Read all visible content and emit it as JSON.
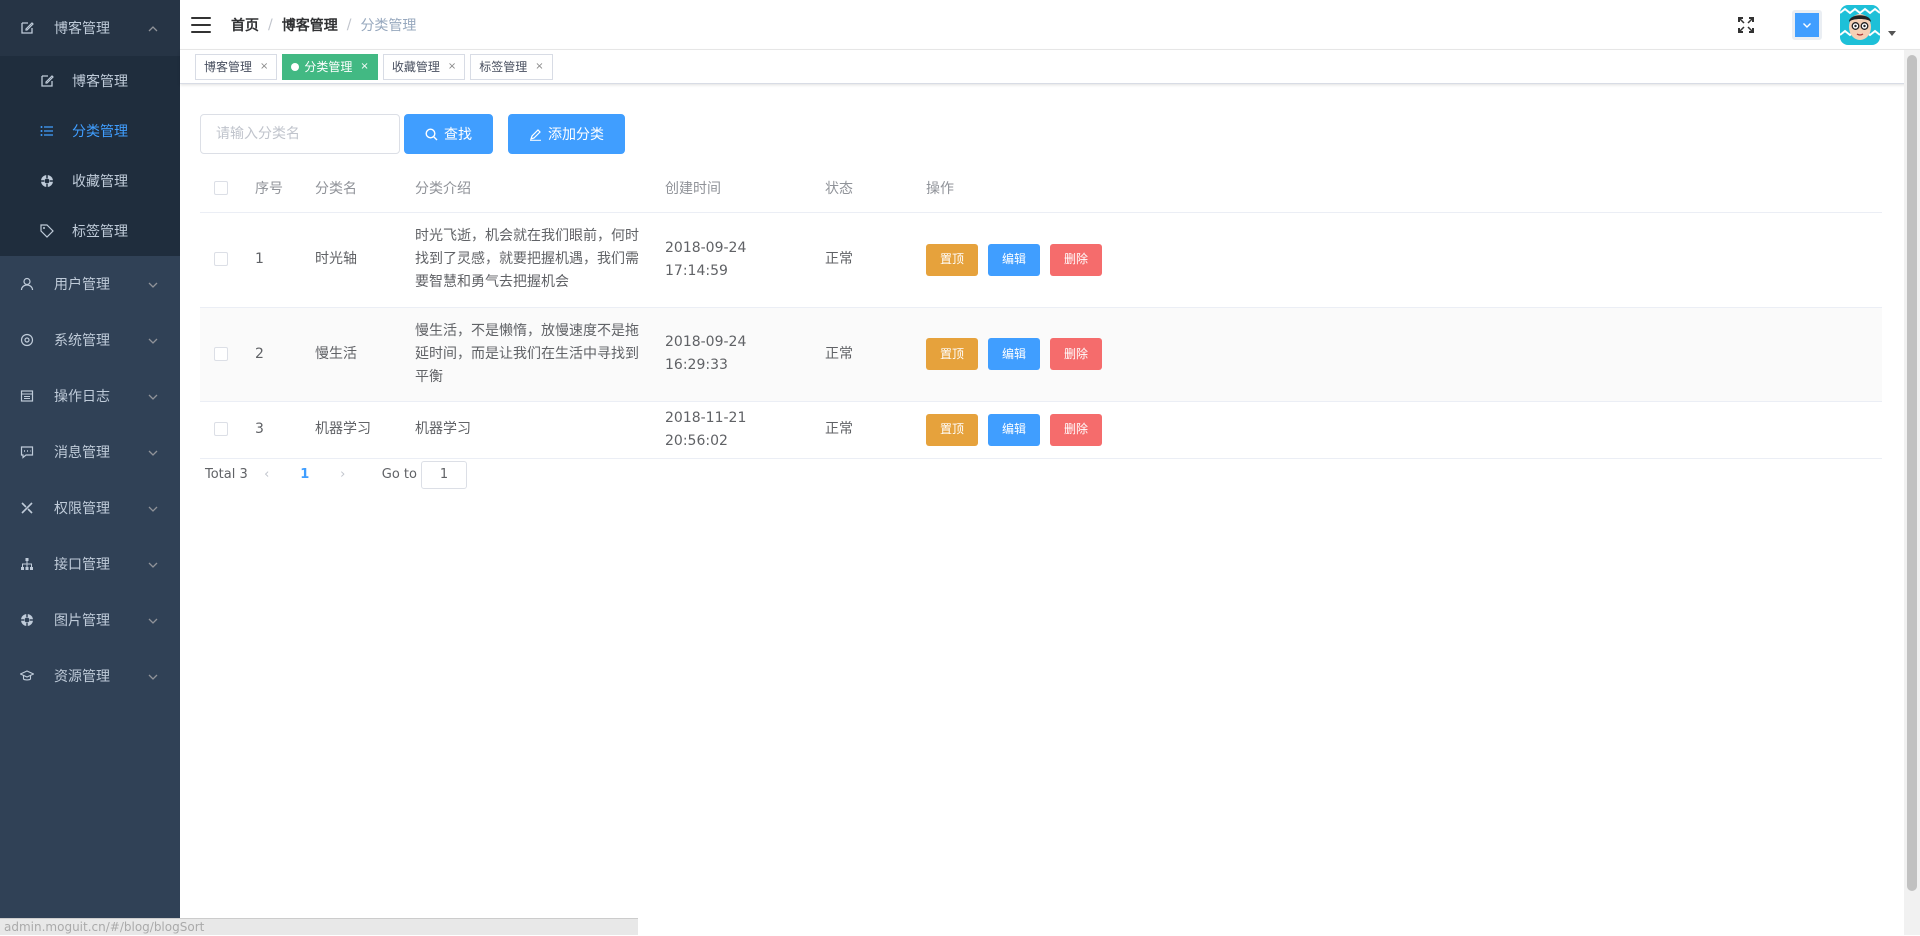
{
  "sidebar": {
    "groups": [
      {
        "label": "博客管理",
        "icon": "edit-icon",
        "expanded": true,
        "items": [
          {
            "label": "博客管理",
            "icon": "edit-icon"
          },
          {
            "label": "分类管理",
            "icon": "list-icon",
            "active": true
          },
          {
            "label": "收藏管理",
            "icon": "lifebuoy-icon"
          },
          {
            "label": "标签管理",
            "icon": "tag-icon"
          }
        ]
      },
      {
        "label": "用户管理",
        "icon": "user-icon"
      },
      {
        "label": "系统管理",
        "icon": "settings-icon"
      },
      {
        "label": "操作日志",
        "icon": "calendar-icon"
      },
      {
        "label": "消息管理",
        "icon": "message-icon"
      },
      {
        "label": "权限管理",
        "icon": "tools-icon"
      },
      {
        "label": "接口管理",
        "icon": "sitemap-icon"
      },
      {
        "label": "图片管理",
        "icon": "lifebuoy-icon"
      },
      {
        "label": "资源管理",
        "icon": "graduation-cap-icon"
      }
    ],
    "status_url": "admin.moguit.cn/#/blog/blogSort"
  },
  "breadcrumb": {
    "home": "首页",
    "parent": "博客管理",
    "current": "分类管理",
    "separator": "/"
  },
  "tags": [
    {
      "label": "博客管理",
      "close": "×"
    },
    {
      "label": "分类管理",
      "close": "×",
      "active": true
    },
    {
      "label": "收藏管理",
      "close": "×"
    },
    {
      "label": "标签管理",
      "close": "×"
    }
  ],
  "filter": {
    "placeholder": "请输入分类名",
    "search_label": "查找",
    "add_label": "添加分类"
  },
  "table": {
    "headers": [
      "序号",
      "分类名",
      "分类介绍",
      "创建时间",
      "状态",
      "操作"
    ],
    "rows": [
      {
        "index": "1",
        "name": "时光轴",
        "intro": "时光飞逝，机会就在我们眼前，何时找到了灵感，就要把握机遇，我们需要智慧和勇气去把握机会",
        "time": "2018-09-24 17:14:59",
        "status": "正常"
      },
      {
        "index": "2",
        "name": "慢生活",
        "intro": "慢生活，不是懒惰，放慢速度不是拖延时间，而是让我们在生活中寻找到平衡",
        "time": "2018-09-24 16:29:33",
        "status": "正常"
      },
      {
        "index": "3",
        "name": "机器学习",
        "intro": "机器学习",
        "time": "2018-11-21 20:56:02",
        "status": "正常"
      }
    ],
    "actions": {
      "top": "置顶",
      "edit": "编辑",
      "delete": "删除"
    }
  },
  "pagination": {
    "total": "Total 3",
    "current_page": "1",
    "goto_label": "Go to",
    "goto_value": "1"
  },
  "colors": {
    "sidebar_bg": "#304156",
    "primary": "#409eff",
    "warning": "#e6a23c",
    "danger": "#f56c6c",
    "tag_active": "#42b983"
  }
}
